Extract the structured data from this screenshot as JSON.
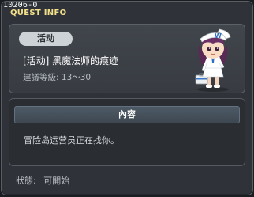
{
  "window": {
    "quest_id": "10206-0",
    "title": "QUEST INFO"
  },
  "quest": {
    "category": "活动",
    "name": "[活动] 黑魔法师的痕迹",
    "level_label": "建議等級:",
    "level_range": "13～30",
    "npc_icon": "maple-administrator-npc-portrait"
  },
  "content": {
    "header": "內容",
    "text": "冒险岛运营员正在找你。"
  },
  "status": {
    "label": "狀態:",
    "value": "可開始"
  },
  "colors": {
    "title": "#f2e08a",
    "background": "#2f3339",
    "pill": "#cdd2d7"
  }
}
